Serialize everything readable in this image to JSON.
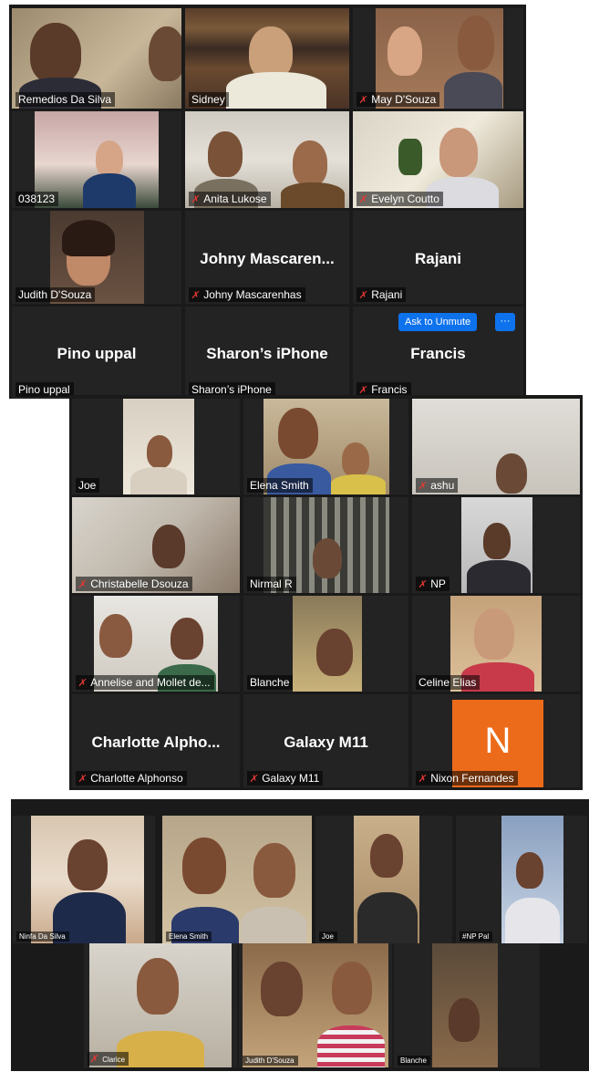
{
  "colors": {
    "panel": "#1a1a1a",
    "tile": "#232323",
    "active_border": "#b9d97a",
    "mute": "#e53935",
    "button": "#0e72ed",
    "avatar_n": "#ec6b1a"
  },
  "screen1": {
    "tiles": [
      {
        "name": "Remedios Da Silva",
        "muted": false,
        "active": true
      },
      {
        "name": "Sidney",
        "muted": false
      },
      {
        "name": "May D'Souza",
        "muted": true
      },
      {
        "name": "038123",
        "muted": false
      },
      {
        "name": "Anita Lukose",
        "muted": true
      },
      {
        "name": "Evelyn Coutto",
        "muted": true
      },
      {
        "name": "Judith D'Souza",
        "muted": false
      },
      {
        "name": "Johny Mascarenhas",
        "display": "Johny  Mascaren...",
        "muted": true
      },
      {
        "name": "Rajani",
        "display": "Rajani",
        "muted": true
      },
      {
        "name": "Pino uppal",
        "display": "Pino uppal",
        "muted": false
      },
      {
        "name": "Sharon’s iPhone",
        "display": "Sharon’s iPhone",
        "muted": false
      },
      {
        "name": "Francis",
        "display": "Francis",
        "muted": true
      }
    ],
    "ask_to_unmute": "Ask to Unmute",
    "more": "···"
  },
  "screen2": {
    "tiles": [
      {
        "name": "Joe",
        "muted": false
      },
      {
        "name": "Elena Smith",
        "muted": false
      },
      {
        "name": "ashu",
        "muted": true
      },
      {
        "name": "Christabelle Dsouza",
        "muted": true
      },
      {
        "name": "Nirmal R",
        "muted": false
      },
      {
        "name": "NP",
        "muted": true
      },
      {
        "name": "Annelise and Mollet de...",
        "muted": true
      },
      {
        "name": "Blanche",
        "muted": false
      },
      {
        "name": "Celine Elias",
        "muted": false
      },
      {
        "name": "Charlotte Alphonso",
        "display": "Charlotte  Alpho...",
        "muted": true
      },
      {
        "name": "Galaxy M11",
        "display": "Galaxy M11",
        "muted": true
      },
      {
        "name": "Nixon Fernandes",
        "avatar": "N",
        "muted": true
      }
    ]
  },
  "screen3": {
    "tiles": [
      {
        "name": "Ninfa Da Silva",
        "muted": false
      },
      {
        "name": "Elena Smith",
        "muted": false,
        "active": true
      },
      {
        "name": "Joe",
        "muted": false
      },
      {
        "name": "#NP Pal",
        "muted": false
      },
      {
        "name": "Clarice",
        "muted": true
      },
      {
        "name": "Judith D'Souza",
        "muted": false
      },
      {
        "name": "Blanche",
        "muted": false
      }
    ]
  }
}
